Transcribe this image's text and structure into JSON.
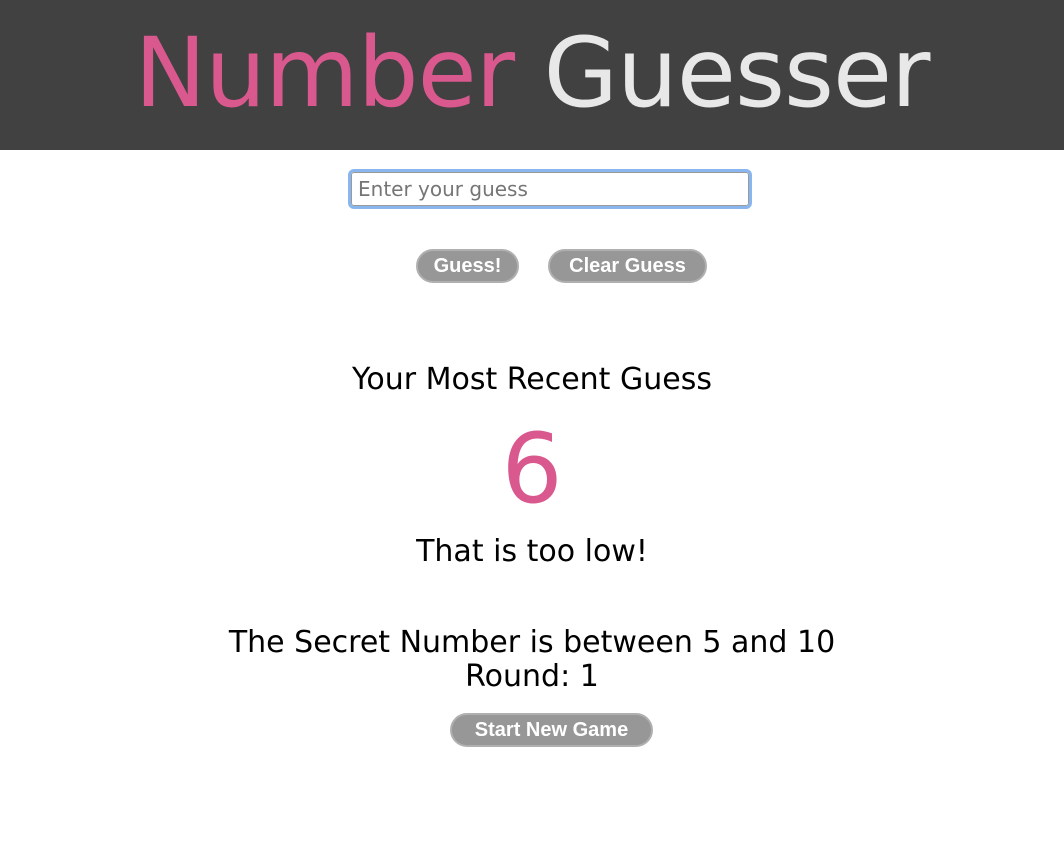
{
  "header": {
    "title_part1": "Number",
    "title_part2": "Guesser"
  },
  "guess_input": {
    "value": "",
    "placeholder": "Enter your guess"
  },
  "buttons": {
    "guess": "Guess!",
    "clear": "Clear Guess",
    "new_game": "Start New Game"
  },
  "results": {
    "label": "Your Most Recent Guess",
    "last_guess": "6",
    "feedback": "That is too low!",
    "range": "The Secret Number is between 5 and 10",
    "round_label": "Round:",
    "round": "1"
  },
  "colors": {
    "accent": "#d9588e",
    "header_bg": "#414141",
    "header_text_secondary": "#e8e8e8",
    "button_bg": "#979797",
    "focus_ring": "#8ab6f0"
  }
}
